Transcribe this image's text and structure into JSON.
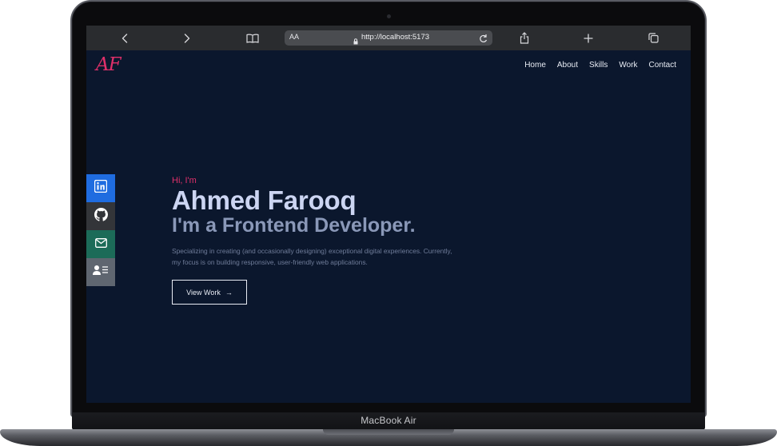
{
  "device": {
    "label": "MacBook Air"
  },
  "browser": {
    "text_size_label": "AA",
    "url": "http://localhost:5173"
  },
  "site": {
    "logo": "AF",
    "nav": [
      "Home",
      "About",
      "Skills",
      "Work",
      "Contact"
    ],
    "social": [
      {
        "name": "linkedin-icon",
        "color": "#1f6ce0"
      },
      {
        "name": "github-icon",
        "color": "#333539"
      },
      {
        "name": "mail-icon",
        "color": "#1c6b58"
      },
      {
        "name": "resume-icon",
        "color": "#5f6670"
      }
    ],
    "hero": {
      "greeting": "Hi, I'm",
      "name": "Ahmed Farooq",
      "role": "I'm a Frontend Developer.",
      "description_line1": "Specializing in creating (and occasionally designing) exceptional digital experiences. Currently,",
      "description_line2": "my focus is on building responsive, user-friendly web applications.",
      "cta_label": "View Work",
      "cta_arrow": "→"
    }
  },
  "colors": {
    "background": "#0b172d",
    "accent": "#e0306a",
    "heading": "#ccd5f2",
    "subheading": "#8a98b8"
  }
}
